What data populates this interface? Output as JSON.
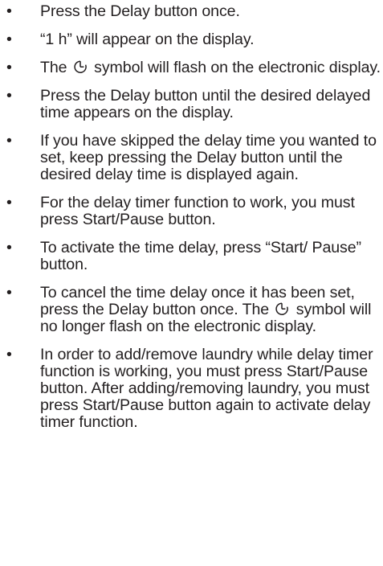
{
  "bullet_char": "•",
  "items": [
    {
      "text": "Press the Delay button once."
    },
    {
      "text": " “1 h” will appear on the display."
    },
    {
      "before": "The ",
      "icon": "delay-timer-icon",
      "after": " symbol will flash on the electronic display."
    },
    {
      "text": "Press the Delay button until the desired delayed time appears on the display."
    },
    {
      "text": " If you have skipped the delay time you wanted to set, keep pressing the Delay button until the desired delay time is displayed again."
    },
    {
      "text": "For the delay timer function to work, you must press Start/Pause button."
    },
    {
      "text": "To activate the time delay, press “Start/ Pause” button."
    },
    {
      "before": "To cancel the time delay once it has been set, press the Delay button once. The ",
      "icon": "delay-timer-icon",
      "after": " symbol will no longer flash on the electronic display."
    },
    {
      "text": "In order to add/remove laundry while delay timer function is working, you must press Start/Pause button. After adding/removing laundry, you must press Start/Pause button again to activate delay timer function."
    }
  ]
}
